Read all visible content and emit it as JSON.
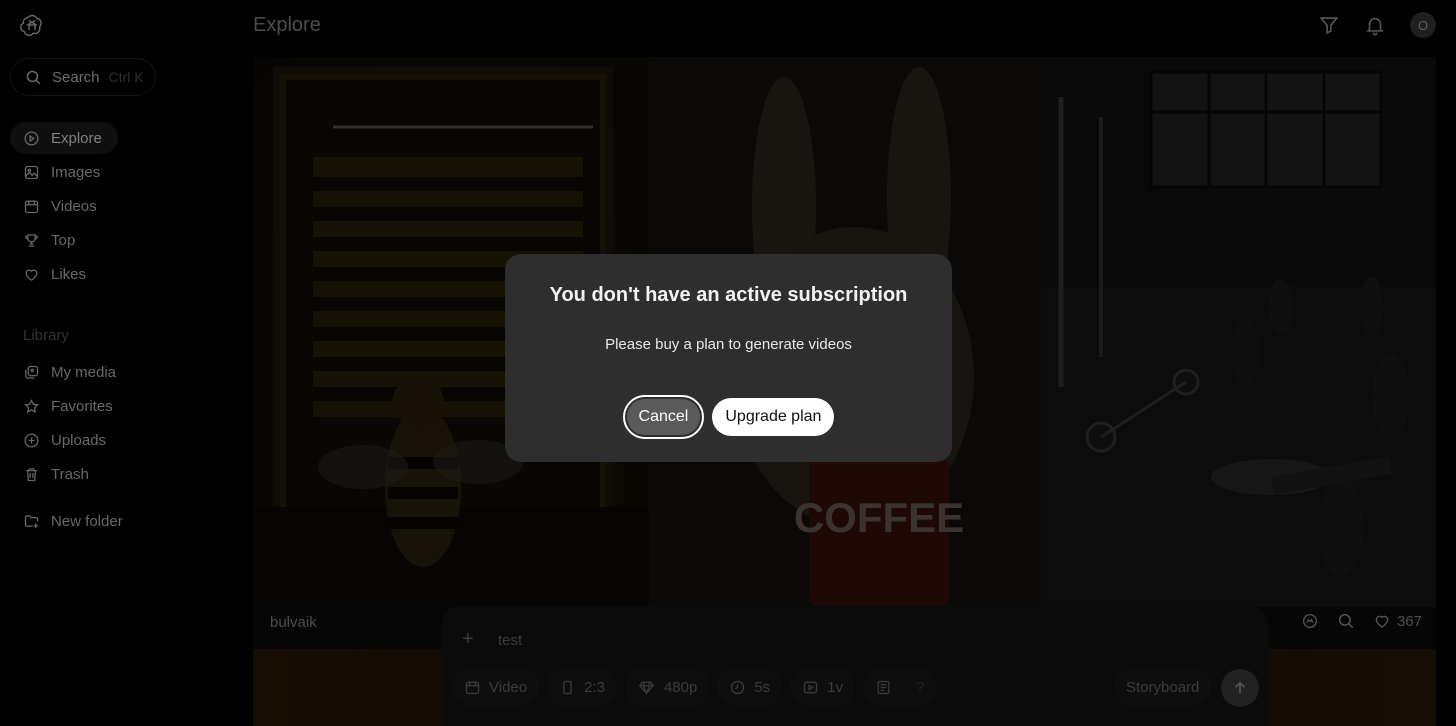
{
  "header": {
    "title": "Explore",
    "avatar_initial": "O"
  },
  "search": {
    "label": "Search",
    "shortcut": "Ctrl K"
  },
  "nav": [
    {
      "label": "Explore",
      "icon": "play-circle-icon",
      "active": true
    },
    {
      "label": "Images",
      "icon": "image-icon"
    },
    {
      "label": "Videos",
      "icon": "calendar-film-icon"
    },
    {
      "label": "Top",
      "icon": "trophy-icon"
    },
    {
      "label": "Likes",
      "icon": "heart-icon"
    }
  ],
  "library": {
    "title": "Library",
    "items": [
      {
        "label": "My media",
        "icon": "media-icon"
      },
      {
        "label": "Favorites",
        "icon": "star-icon"
      },
      {
        "label": "Uploads",
        "icon": "plus-circle-icon"
      },
      {
        "label": "Trash",
        "icon": "trash-icon"
      }
    ],
    "new_folder": "New folder"
  },
  "card": {
    "author": "bulvaik",
    "likes": "367",
    "coffee_text": "COFFEE"
  },
  "composer": {
    "prompt": "test",
    "chips": {
      "type": "Video",
      "aspect": "2:3",
      "resolution": "480p",
      "duration": "5s",
      "variations": "1v",
      "help": "?"
    },
    "storyboard": "Storyboard"
  },
  "modal": {
    "title": "You don't have an active subscription",
    "message": "Please buy a plan to generate videos",
    "cancel": "Cancel",
    "upgrade": "Upgrade plan"
  }
}
